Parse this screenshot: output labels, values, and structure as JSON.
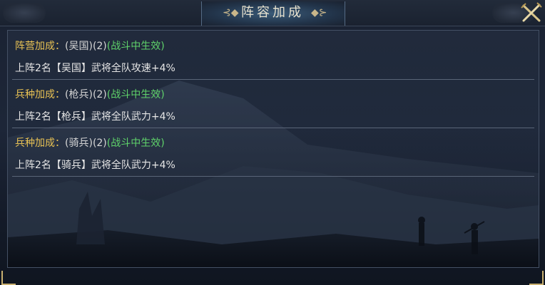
{
  "window": {
    "title": "阵容加成",
    "close_icon": "crossed-swords-close-icon"
  },
  "bonuses": [
    {
      "label": "阵营加成：",
      "name": "(吴国)",
      "count": "(2)",
      "status": "(战斗中生效)",
      "description": "上阵2名【吴国】武将全队攻速+4%"
    },
    {
      "label": "兵种加成：",
      "name": "(枪兵)",
      "count": "(2)",
      "status": "(战斗中生效)",
      "description": "上阵2名【枪兵】武将全队武力+4%"
    },
    {
      "label": "兵种加成：",
      "name": "(骑兵)",
      "count": "(2)",
      "status": "(战斗中生效)",
      "description": "上阵2名【骑兵】武将全队武力+4%"
    }
  ],
  "colors": {
    "label": "#e8c254",
    "active_status": "#5fd26a",
    "body_text": "#e6e6e6",
    "title_text": "#e8e2cf"
  }
}
